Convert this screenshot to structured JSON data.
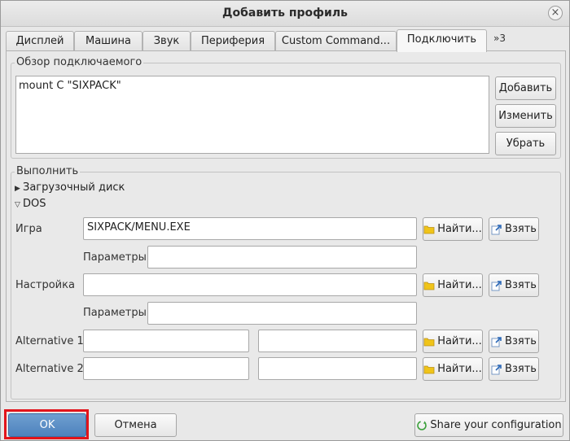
{
  "window": {
    "title": "Добавить профиль",
    "close_glyph": "×"
  },
  "tabs": [
    {
      "label": "Дисплей"
    },
    {
      "label": "Машина"
    },
    {
      "label": "Звук"
    },
    {
      "label": "Периферия"
    },
    {
      "label": "Custom Command..."
    },
    {
      "label": "Подключить",
      "active": true
    }
  ],
  "tabs_more": "»3",
  "mount_group": {
    "title": "Обзор подключаемого",
    "items": [
      "mount C \"SIXPACK\""
    ],
    "buttons": {
      "add": "Добавить",
      "edit": "Изменить",
      "remove": "Убрать"
    }
  },
  "execute_group": {
    "title": "Выполнить",
    "boot_disk": "Загрузочный диск",
    "dos": "DOS",
    "rows": {
      "game": {
        "label": "Игра",
        "value": "SIXPACK/MENU.EXE",
        "params_label": "Параметры",
        "params_value": ""
      },
      "setup": {
        "label": "Настройка",
        "value": "",
        "params_label": "Параметры",
        "params_value": ""
      },
      "alt1": {
        "label": "Alternative 1",
        "value": "",
        "value2": ""
      },
      "alt2": {
        "label": "Alternative 2",
        "value": "",
        "value2": ""
      }
    },
    "browse_label": "Найти...",
    "grab_label": "Взять"
  },
  "footer": {
    "ok": "OK",
    "cancel": "Отмена",
    "share": "Share your configuration"
  },
  "colors": {
    "ok_button": "#5a8cc4",
    "highlight": "#e2141b",
    "folder": "#f0c419",
    "share_icon": "#3aa03a"
  }
}
